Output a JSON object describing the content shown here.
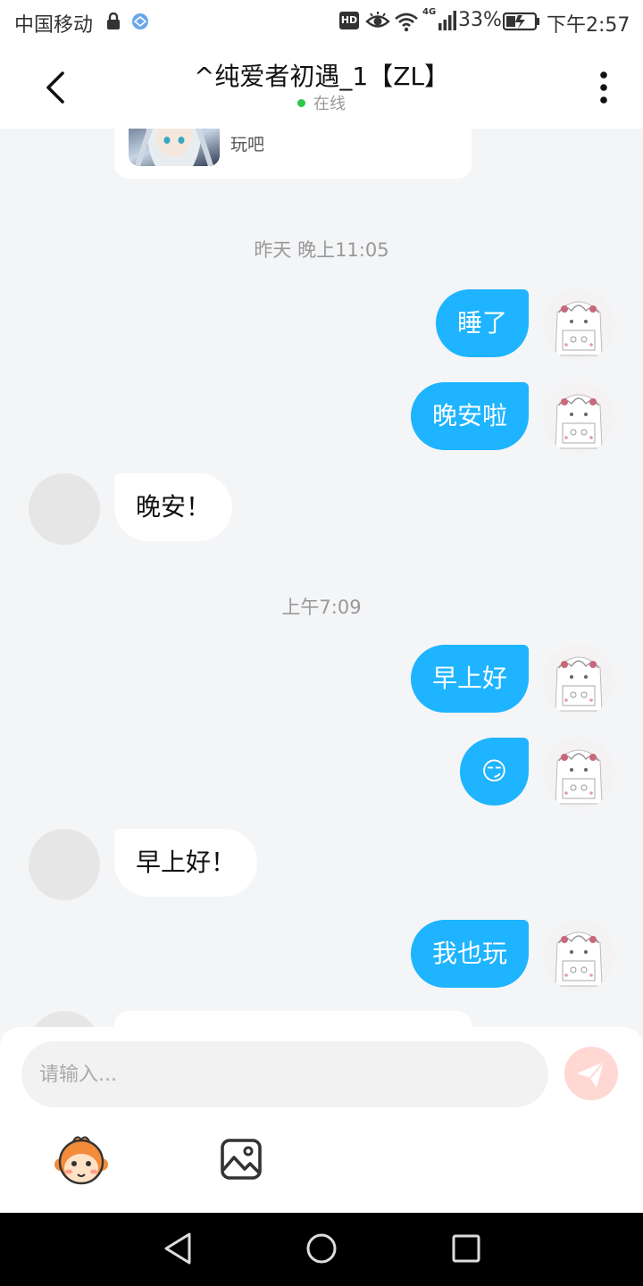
{
  "status_bar": {
    "carrier": "中国移动",
    "hd_label": "HD",
    "network_type": "4G",
    "battery_percent": "33%",
    "time": "下午2:57"
  },
  "header": {
    "title": "^纯爱者初遇_1【ZL】",
    "status": "在线",
    "status_color": "#2dc84d"
  },
  "shared_card": {
    "text": "玩吧"
  },
  "messages": [
    {
      "type": "time",
      "text": "昨天 晚上11:05"
    },
    {
      "type": "out",
      "text": "睡了"
    },
    {
      "type": "out",
      "text": "晚安啦"
    },
    {
      "type": "in",
      "text": "晚安！"
    },
    {
      "type": "time",
      "text": "上午7:09"
    },
    {
      "type": "out",
      "text": "早上好"
    },
    {
      "type": "out",
      "text": "😏"
    },
    {
      "type": "in",
      "text": "早上好！"
    },
    {
      "type": "out",
      "text": "我也玩"
    }
  ],
  "input": {
    "placeholder": "请输入..."
  },
  "icons": {
    "toolbar": [
      "monkey-emoji-icon",
      "image-icon"
    ],
    "navigation": [
      "back-triangle-icon",
      "home-circle-icon",
      "recent-square-icon"
    ]
  },
  "colors": {
    "outgoing_bubble": "#1eb4ff",
    "incoming_bubble": "#ffffff",
    "send_button": "#ffd8d4"
  }
}
